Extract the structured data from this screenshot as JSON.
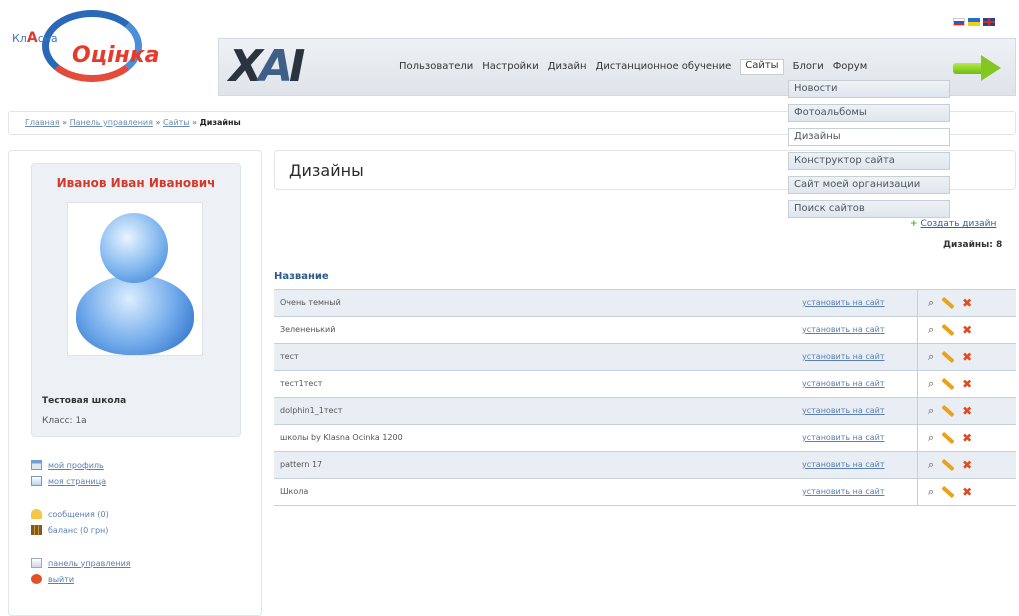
{
  "logo": {
    "prefix": "Кл",
    "accent": "А",
    "suffix": "сна",
    "main": "Оцінка"
  },
  "brand": {
    "x": "X",
    "a": "A",
    "i": "I"
  },
  "flags": [
    "ru",
    "ua",
    "gb"
  ],
  "menu": {
    "items": [
      "Пользователи",
      "Настройки",
      "Дизайн",
      "Дистанционное обучение",
      "Сайты",
      "Блоги",
      "Форум"
    ],
    "active_index": 4,
    "dropdown": [
      "Новости",
      "Фотоальбомы",
      "Дизайны",
      "Конструктор сайта",
      "Сайт моей организации",
      "Поиск сайтов"
    ],
    "dropdown_selected": 2
  },
  "breadcrumb": {
    "home": "Главная",
    "panel": "Панель управления",
    "sites": "Сайты",
    "current": "Дизайны",
    "sep": "»"
  },
  "profile": {
    "name": "Иванов Иван Иванович",
    "school": "Тестовая школа",
    "class": "Класс: 1а"
  },
  "side_links": {
    "my_profile": "мой профиль",
    "my_page": "моя страница",
    "messages": "сообщения (0)",
    "balance": "баланс (0 грн)",
    "control_panel": "панель управления",
    "logout": "выйти"
  },
  "main": {
    "title": "Дизайны",
    "create_link": "Создать дизайн",
    "count_label": "Дизайны: 8",
    "column_name": "Название",
    "install_label": "установить на сайт",
    "rows": [
      "Очень темный",
      "Зелененький",
      "тест",
      "тест1тест",
      "dolphin1_1тест",
      "школы by Klasna Ocinka 1200",
      "pattern 17",
      "Школа"
    ]
  }
}
